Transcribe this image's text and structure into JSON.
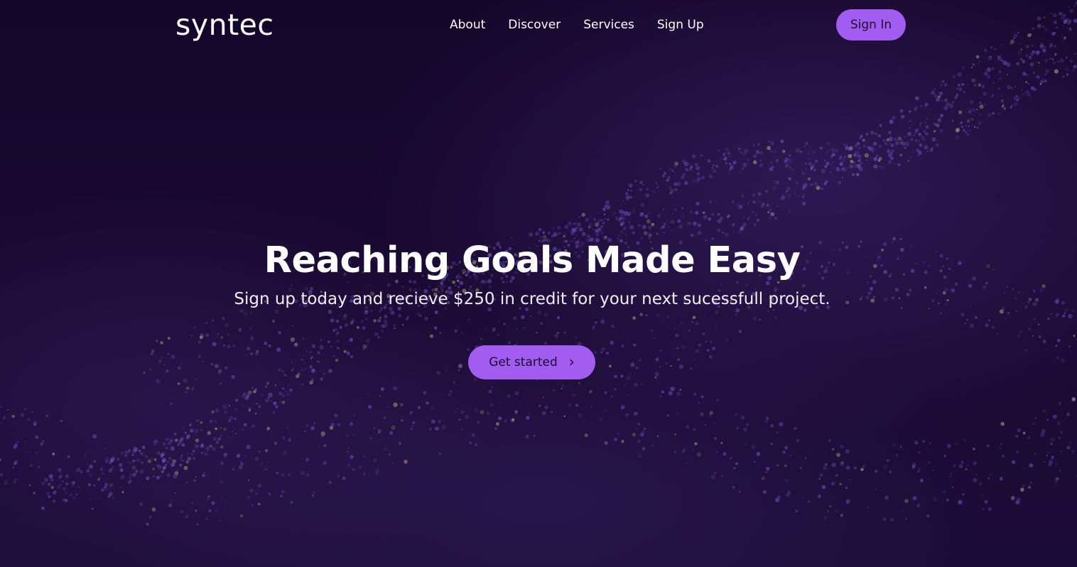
{
  "brand": {
    "name": "syntec"
  },
  "nav": {
    "links": [
      "About",
      "Discover",
      "Services",
      "Sign Up"
    ],
    "signin_label": "Sign In"
  },
  "hero": {
    "title": "Reaching Goals Made Easy",
    "subtitle": "Sign up today and recieve $250 in credit for your next sucessfull project.",
    "cta_label": "Get started",
    "cta_icon": "chevron-right-icon"
  },
  "colors": {
    "background": "#14062a",
    "accent": "#a25cf0",
    "particle": "#6b4fb8",
    "particle_highlight": "#b8a070"
  }
}
